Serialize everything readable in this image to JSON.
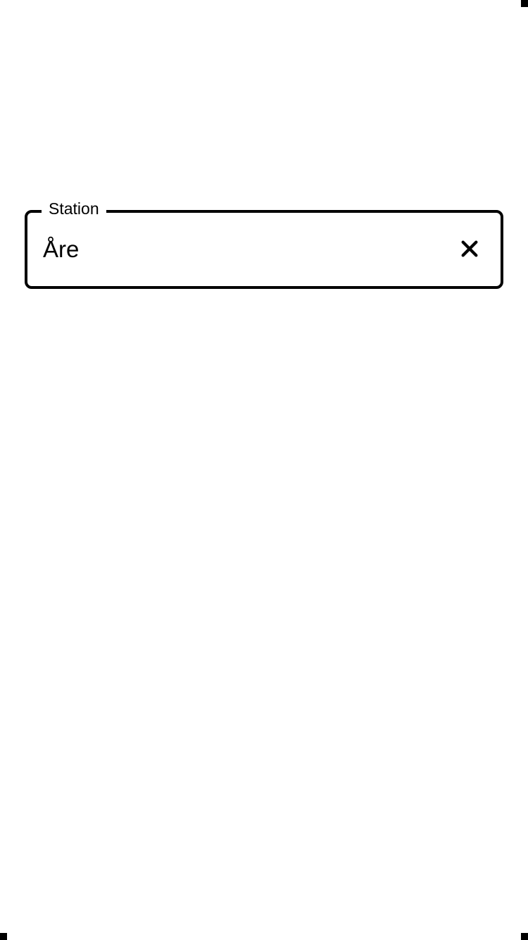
{
  "station_field": {
    "label": "Station",
    "value": "Åre",
    "placeholder": ""
  },
  "icons": {
    "clear": "close-icon"
  }
}
